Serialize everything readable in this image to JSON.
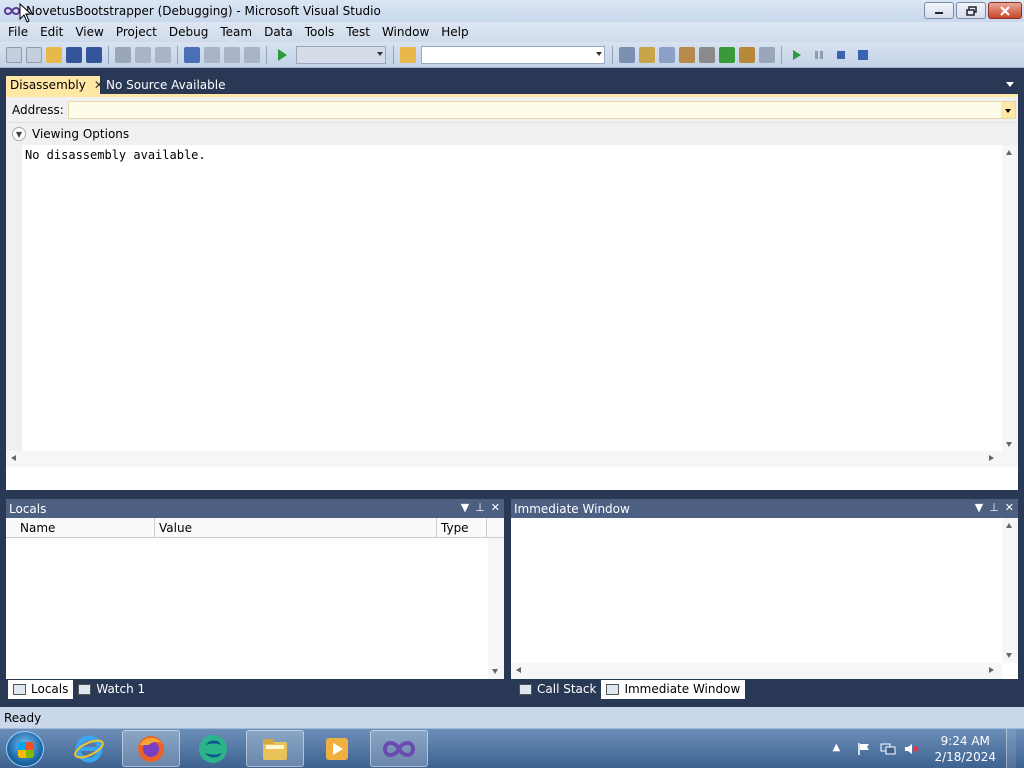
{
  "window": {
    "title": "NovetusBootstrapper (Debugging) - Microsoft Visual Studio",
    "controls": {
      "minimize": "minimize",
      "maximize": "restore",
      "close": "close"
    }
  },
  "menu": [
    "File",
    "Edit",
    "View",
    "Project",
    "Debug",
    "Team",
    "Data",
    "Tools",
    "Test",
    "Window",
    "Help"
  ],
  "toolbar": {
    "solution_config": "",
    "find_box": ""
  },
  "document_tabs": [
    {
      "label": "Disassembly",
      "active": true
    },
    {
      "label": "No Source Available",
      "active": false
    }
  ],
  "disassembly": {
    "address_label": "Address:",
    "address_value": "",
    "viewing_options": "Viewing Options",
    "content": "No disassembly available."
  },
  "locals": {
    "title": "Locals",
    "columns": [
      "Name",
      "Value",
      "Type"
    ],
    "rows": []
  },
  "immediate": {
    "title": "Immediate Window",
    "content": ""
  },
  "left_tabs": [
    {
      "label": "Locals",
      "active": true,
      "icon": "locals-icon"
    },
    {
      "label": "Watch 1",
      "active": false,
      "icon": "watch-icon"
    }
  ],
  "right_tabs": [
    {
      "label": "Call Stack",
      "active": false,
      "icon": "call-stack-icon"
    },
    {
      "label": "Immediate Window",
      "active": true,
      "icon": "immediate-icon"
    }
  ],
  "status": "Ready",
  "taskbar": {
    "apps": [
      "internet-explorer-icon",
      "firefox-icon",
      "app-icon",
      "file-explorer-icon",
      "media-player-icon",
      "visual-studio-icon"
    ],
    "clock_time": "9:24 AM",
    "clock_date": "2/18/2024"
  },
  "colors": {
    "chrome_dark": "#293955",
    "tab_active": "#ffe8a6",
    "toolwindow_header": "#4d6082",
    "status_bar": "#cbd7ea"
  }
}
